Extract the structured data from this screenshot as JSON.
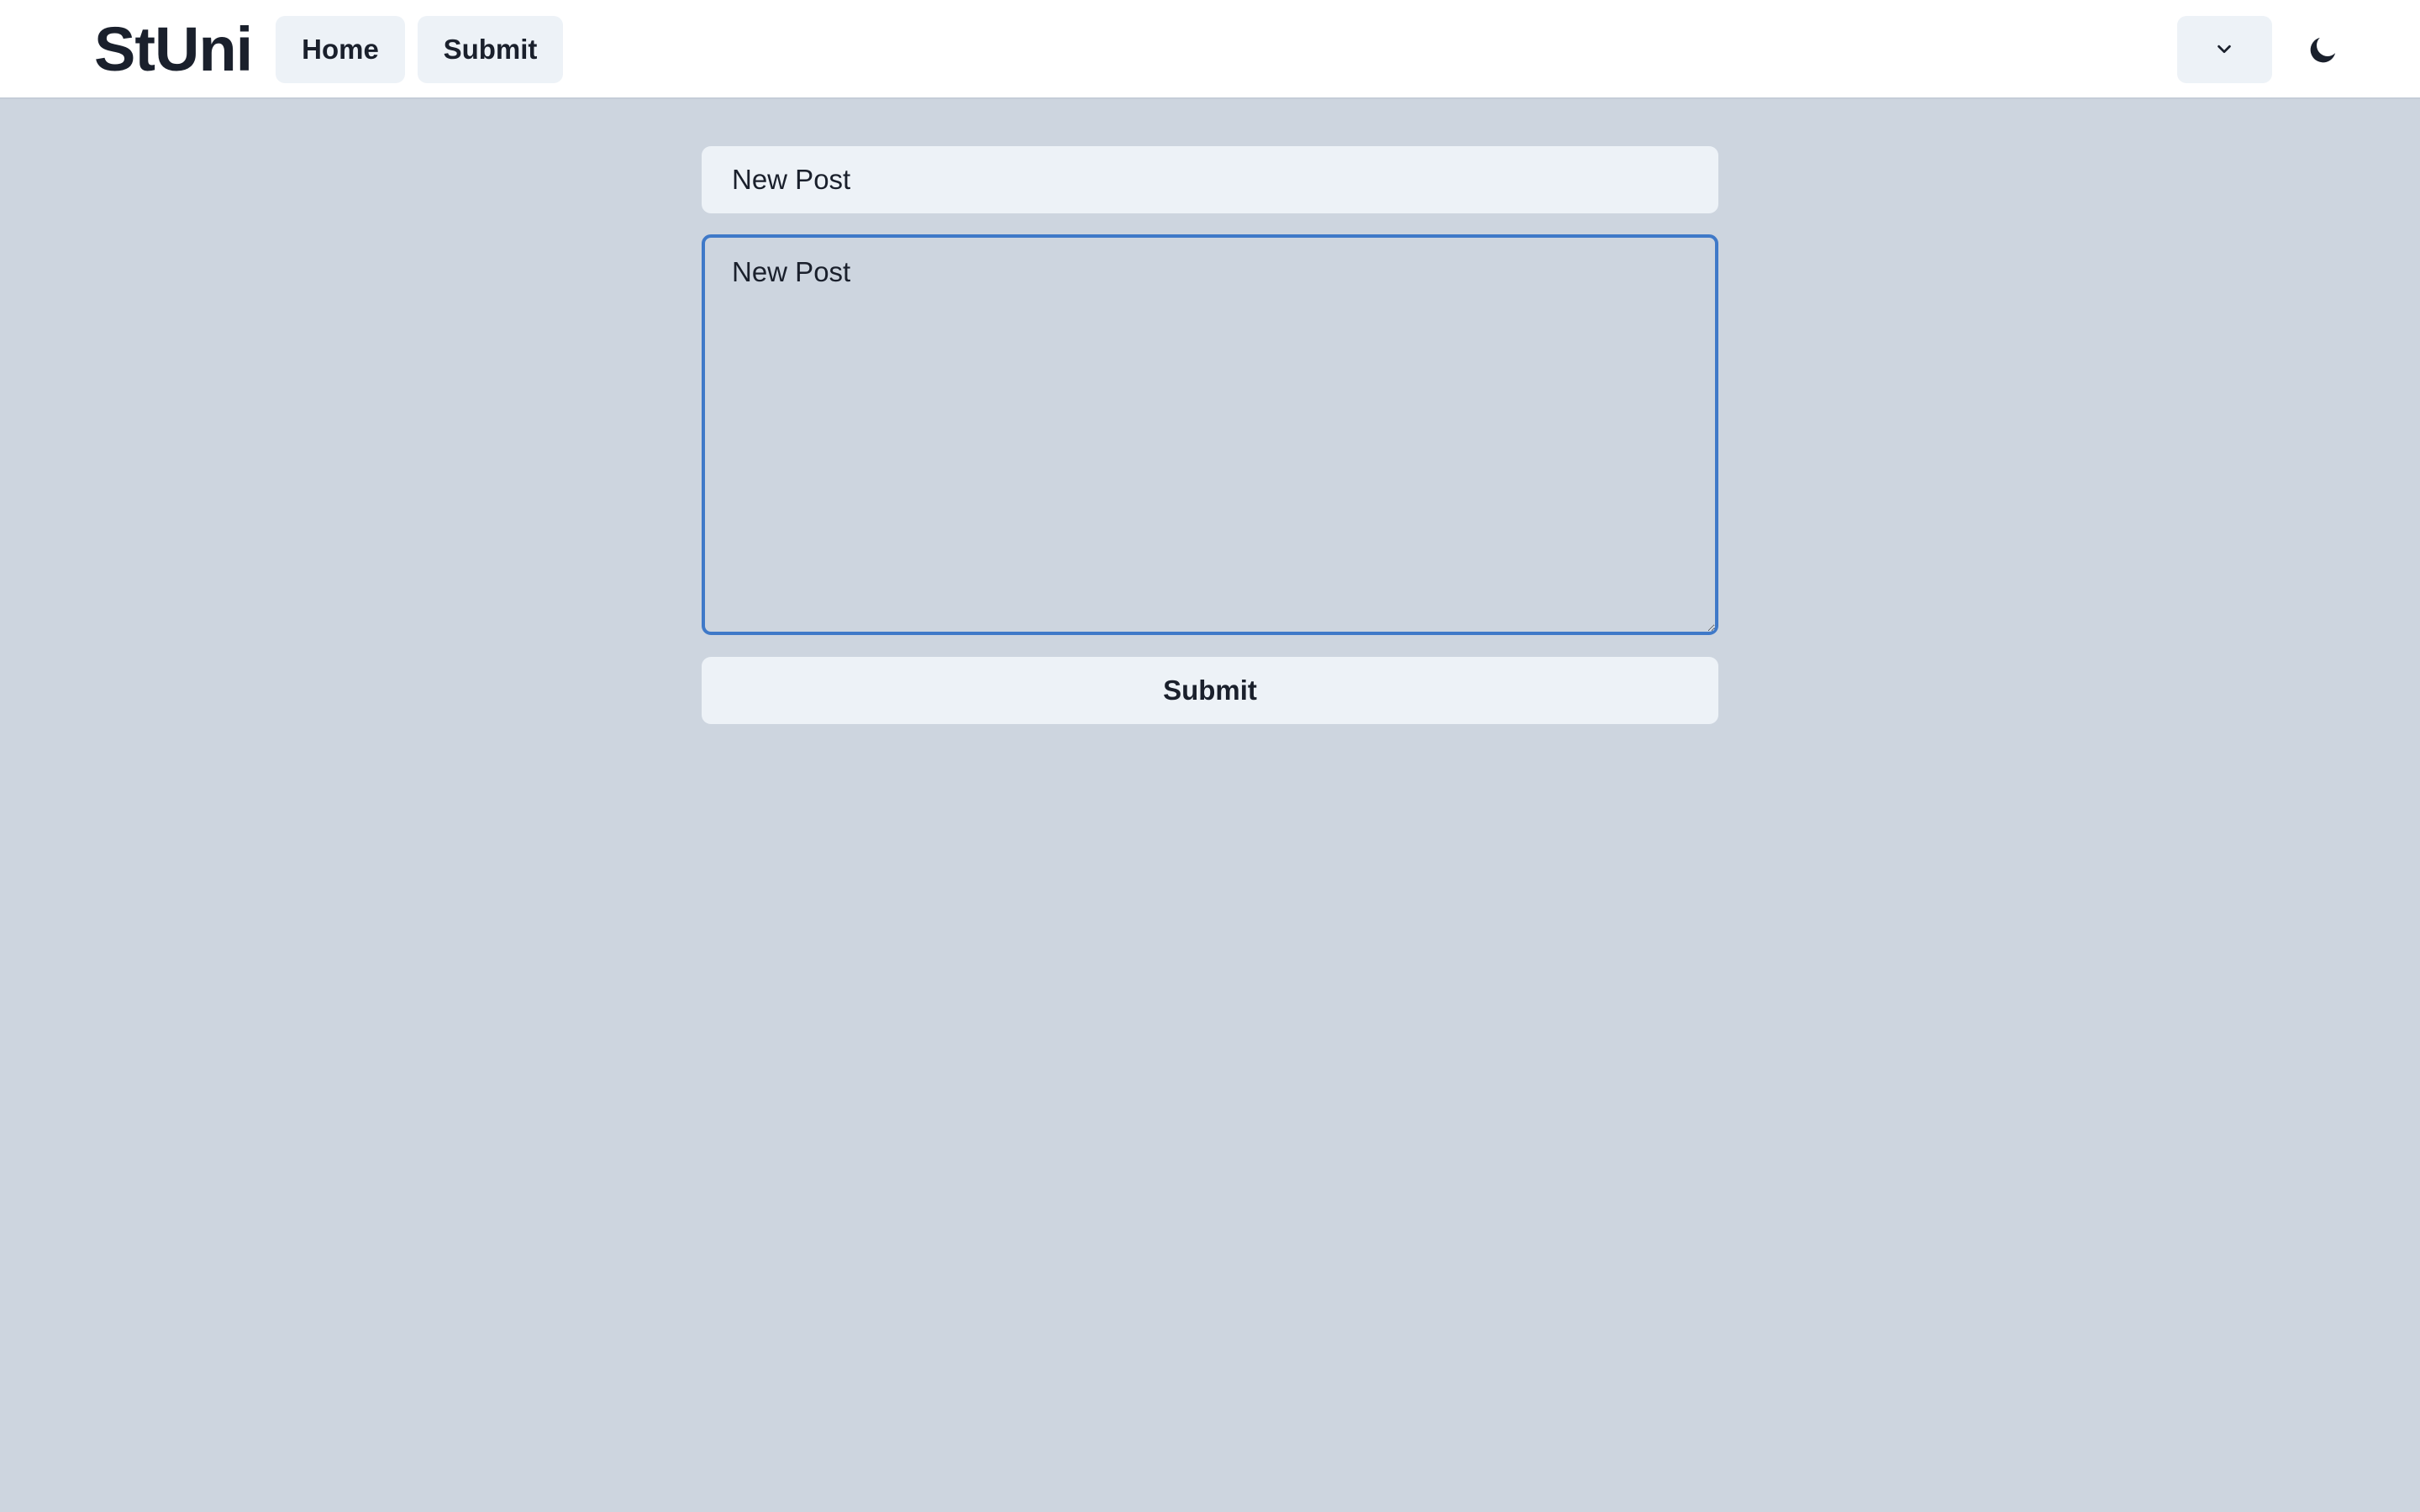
{
  "header": {
    "brand": "StUni",
    "nav": {
      "home_label": "Home",
      "submit_label": "Submit"
    },
    "menu_icon": "chevron-down-icon",
    "theme_icon": "moon-icon"
  },
  "form": {
    "title_value": "New Post",
    "body_value": "New Post",
    "submit_label": "Submit"
  },
  "colors": {
    "page_background": "#cdd5df",
    "header_background": "#ffffff",
    "button_background": "#edf2f7",
    "focus_border": "#3f79c8",
    "text": "#1a202c"
  }
}
